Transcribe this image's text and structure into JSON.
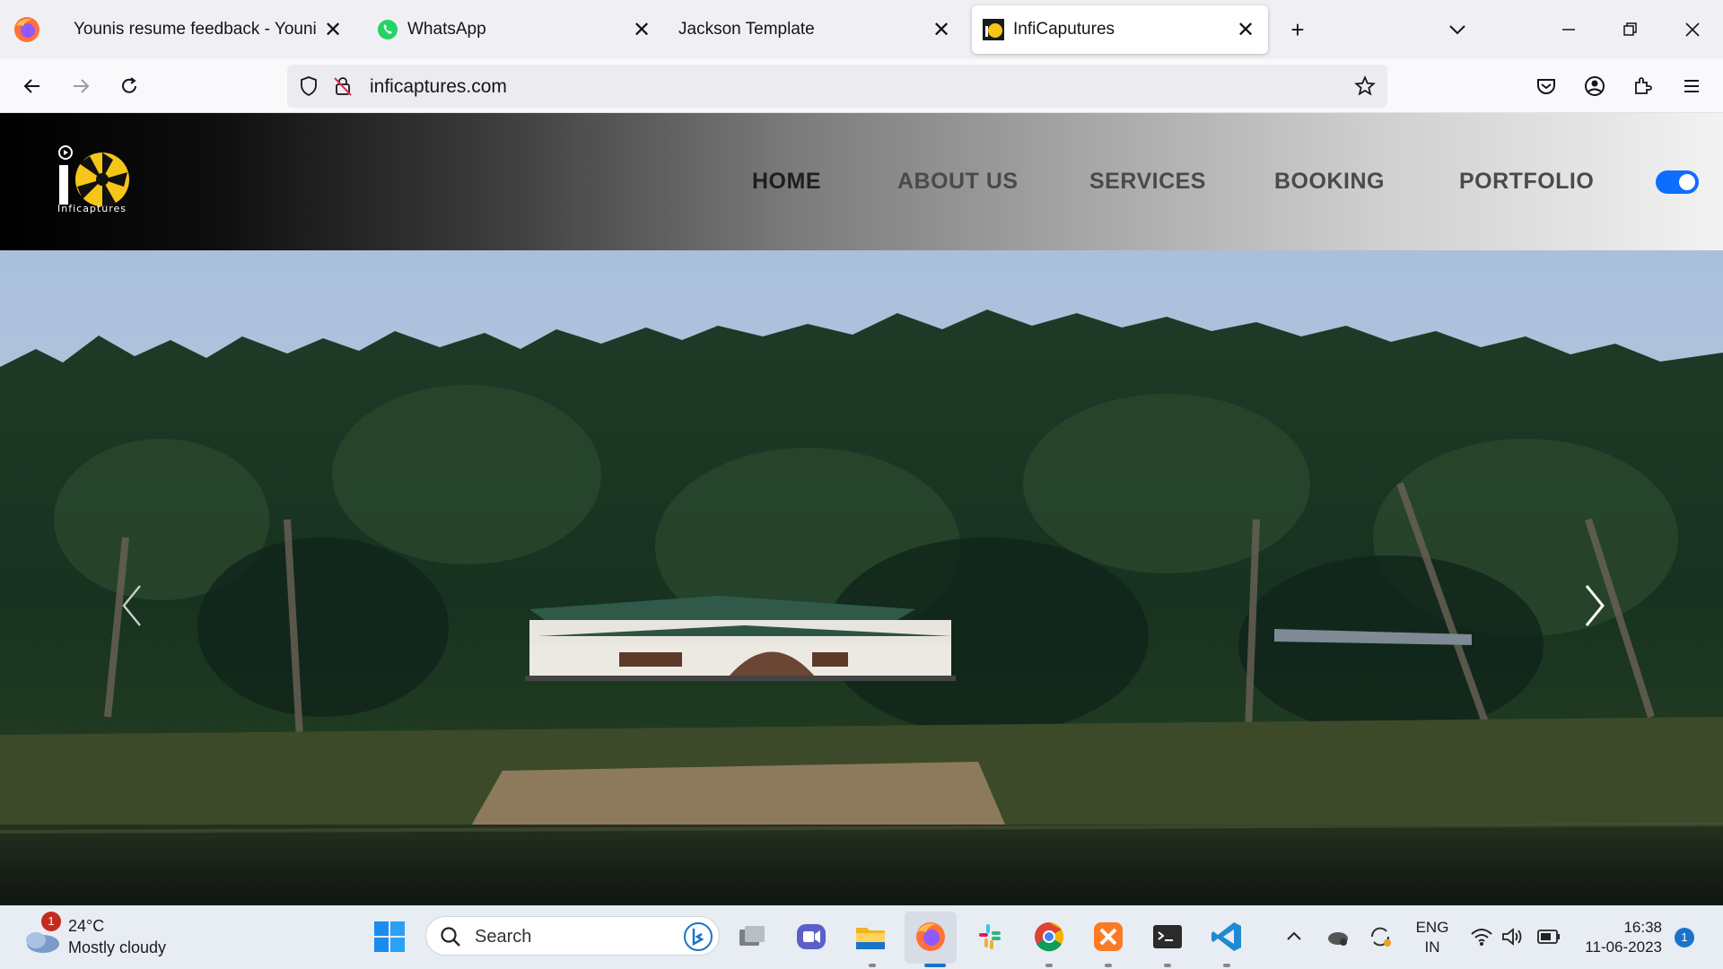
{
  "browser": {
    "tabs": [
      {
        "title": "Younis resume feedback - Younis re",
        "close": "✕"
      },
      {
        "title": "WhatsApp",
        "close": "✕"
      },
      {
        "title": "Jackson Template",
        "close": "✕"
      },
      {
        "title": "InfiCaputures",
        "close": "✕",
        "active": true
      }
    ],
    "new_tab": "+",
    "url": "inficaptures.com"
  },
  "site": {
    "logo_text": "Inficaptures",
    "nav": [
      "HOME",
      "ABOUT US",
      "SERVICES",
      "BOOKING",
      "PORTFOLIO"
    ],
    "active_nav": "HOME",
    "theme_toggle_on": true
  },
  "taskbar": {
    "weather": {
      "temp": "24°C",
      "desc": "Mostly cloudy",
      "badge": "1"
    },
    "search_label": "Search",
    "lang_top": "ENG",
    "lang_bottom": "IN",
    "time": "16:38",
    "date": "11-06-2023",
    "notification_count": "1"
  },
  "colors": {
    "toggle": "#0d6efd",
    "accent_yellow": "#f5c518"
  }
}
